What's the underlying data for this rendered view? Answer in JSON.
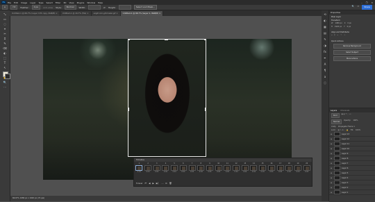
{
  "app": {
    "logo": "Ps"
  },
  "menu": [
    "File",
    "Edit",
    "Image",
    "Layer",
    "Type",
    "Select",
    "Filter",
    "3D",
    "View",
    "Plugins",
    "Window",
    "Help"
  ],
  "window_controls": [
    "–",
    "❐",
    "✕"
  ],
  "options": {
    "feather_label": "Feather:",
    "feather_value": "0 px",
    "antialias": "Anti-alias",
    "style_label": "Style:",
    "style_value": "Normal",
    "width_label": "Width:",
    "height_label": "Height:",
    "select_mask": "Select and Mask...",
    "share": "Share"
  },
  "tabs": [
    {
      "label": "Untitled-1 @ 66.7% (Layer 176 copy, RGB/8)"
    },
    {
      "label": "Untitled-1 @ 16.7% (file)"
    },
    {
      "label": "ezgif.com-gif-maker.gif"
    },
    {
      "label": "Untitled-1 @ 66.7% (Layer 1, RGB/8)",
      "active": true
    }
  ],
  "toolbar": [
    "⤡",
    "▭",
    "◌",
    "⌖",
    "✂",
    "⌗",
    "✎",
    "⌫",
    "◐",
    "⬚",
    "T",
    "↖",
    "▭",
    "✋",
    "🔍",
    "⋯"
  ],
  "colors": {
    "foreground": "#f0ead8",
    "background": "#2b2b2b"
  },
  "properties": {
    "title": "Properties",
    "pixel_layer": "Pixel Layer",
    "transform": "Transform",
    "w_label": "W",
    "w_value": "1080 px",
    "h_label": "H",
    "h_value": "1920 px",
    "x_label": "X",
    "x_value": "0 px",
    "y_label": "Y",
    "y_value": "0 px",
    "align": "Align and Distribute",
    "quick_actions": "Quick Actions",
    "btn_remove_bg": "Remove Background",
    "btn_select_subject": "Select Subject",
    "btn_more": "More Actions"
  },
  "layers": {
    "tabs": [
      "Layers",
      "Channels"
    ],
    "kind": "Kind",
    "blend": "Normal",
    "opacity_label": "Opacity:",
    "opacity_value": "100%",
    "unify": "Unify:",
    "propagate": "Propagate Frame 1",
    "lock_label": "Lock:",
    "fill_label": "Fill:",
    "fill_value": "100%",
    "items": [
      "Layer 13",
      "Layer 12",
      "Layer 11",
      "Layer 10",
      "Layer 9",
      "Layer 8",
      "Layer 7",
      "Layer 6",
      "Layer 5",
      "Layer 4",
      "Layer 3",
      "Layer 2",
      "Layer 1"
    ]
  },
  "timeline": {
    "title": "Timeline",
    "loop": "Forever",
    "frames": [
      {
        "num": "1",
        "dur": "0.04"
      },
      {
        "num": "2",
        "dur": "0.04"
      },
      {
        "num": "3",
        "dur": "0.04"
      },
      {
        "num": "4",
        "dur": "0.04"
      },
      {
        "num": "5",
        "dur": "0.04"
      },
      {
        "num": "6",
        "dur": "0.04"
      },
      {
        "num": "7",
        "dur": "0.04"
      },
      {
        "num": "8",
        "dur": "0.04"
      },
      {
        "num": "9",
        "dur": "0.04"
      },
      {
        "num": "10",
        "dur": "0.04"
      },
      {
        "num": "11",
        "dur": "0.04"
      },
      {
        "num": "12",
        "dur": "0.04"
      },
      {
        "num": "13",
        "dur": "0.04"
      },
      {
        "num": "14",
        "dur": "0.04"
      },
      {
        "num": "15",
        "dur": "0.04"
      },
      {
        "num": "16",
        "dur": "0.04"
      },
      {
        "num": "17",
        "dur": "0.04"
      },
      {
        "num": "18",
        "dur": "0.04"
      },
      {
        "num": "19",
        "dur": "0.04"
      },
      {
        "num": "20",
        "dur": "0.04"
      }
    ]
  },
  "status": {
    "text": "66.67%    1080 px x 1920 px (72 ppi)"
  }
}
